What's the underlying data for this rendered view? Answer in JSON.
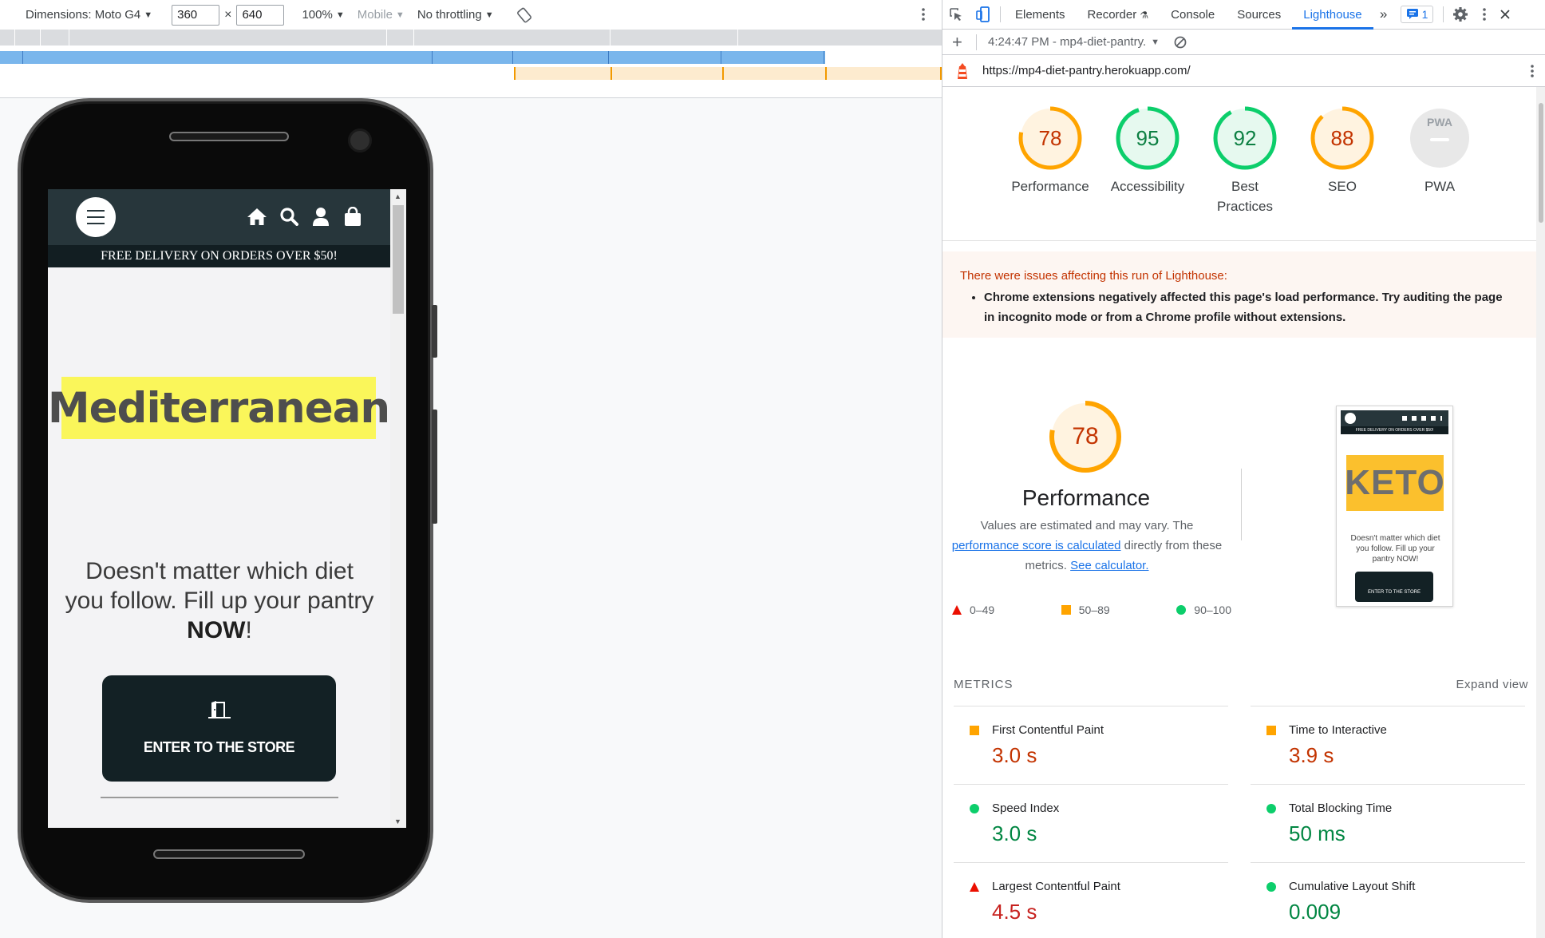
{
  "device_toolbar": {
    "dimensions_label": "Dimensions: Moto G4",
    "width_value": "360",
    "times": "×",
    "height_value": "640",
    "zoom": "100%",
    "device_type": "Mobile",
    "throttling": "No throttling"
  },
  "site": {
    "delivery_banner": "FREE DELIVERY ON ORDERS OVER $50!",
    "headline": "Mediterranean",
    "tagline_before": "Doesn't matter which diet you follow. Fill up your pantry ",
    "tagline_bold": "NOW",
    "tagline_after": "!",
    "cta_label": "ENTER TO THE STORE"
  },
  "devtools": {
    "tabs": [
      "Elements",
      "Recorder",
      "Console",
      "Sources",
      "Lighthouse"
    ],
    "active_tab": "Lighthouse",
    "issues_count": "1",
    "report_selector": "4:24:47 PM - mp4-diet-pantry.",
    "url": "https://mp4-diet-pantry.herokuapp.com/"
  },
  "categories": [
    {
      "score": 78,
      "label": "Performance",
      "color": "#c33300",
      "ring": "#ffa400",
      "fill": "#fff3e0"
    },
    {
      "score": 95,
      "label": "Accessibility",
      "color": "#0d8043",
      "ring": "#0cce6b",
      "fill": "#e6f9ef"
    },
    {
      "score": 92,
      "label": "Best Practices",
      "color": "#0d8043",
      "ring": "#0cce6b",
      "fill": "#e6f9ef"
    },
    {
      "score": 88,
      "label": "SEO",
      "color": "#c33300",
      "ring": "#ffa400",
      "fill": "#fff3e0"
    },
    {
      "score": "PWA",
      "label": "PWA",
      "color": "#9aa0a6",
      "ring": "#e0e0e0",
      "fill": "#e8e8e8"
    }
  ],
  "warning": {
    "title": "There were issues affecting this run of Lighthouse:",
    "item": "Chrome extensions negatively affected this page's load performance. Try auditing the page in incognito mode or from a Chrome profile without extensions."
  },
  "performance": {
    "score": "78",
    "title": "Performance",
    "desc_1": "Values are estimated and may vary. The ",
    "link_1": "performance score is calculated",
    "desc_2": " directly from these metrics. ",
    "link_2": "See calculator.",
    "legend": [
      "0–49",
      "50–89",
      "90–100"
    ],
    "thumb_word": "KETO",
    "thumb_banner": "FREE DELIVERY ON ORDERS OVER $50!",
    "thumb_text": "Doesn't matter which diet you follow. Fill up your pantry NOW!",
    "thumb_cta": "ENTER TO THE STORE"
  },
  "metrics": {
    "heading": "METRICS",
    "expand": "Expand view",
    "items": [
      {
        "name": "First Contentful Paint",
        "value": "3.0 s",
        "status": "average"
      },
      {
        "name": "Time to Interactive",
        "value": "3.9 s",
        "status": "average"
      },
      {
        "name": "Speed Index",
        "value": "3.0 s",
        "status": "pass"
      },
      {
        "name": "Total Blocking Time",
        "value": "50 ms",
        "status": "pass"
      },
      {
        "name": "Largest Contentful Paint",
        "value": "4.5 s",
        "status": "fail"
      },
      {
        "name": "Cumulative Layout Shift",
        "value": "0.009",
        "status": "pass"
      }
    ]
  },
  "colors": {
    "fail": "#eb0f00",
    "average": "#ffa400",
    "pass": "#0cce6b",
    "link": "#1a73e8"
  }
}
